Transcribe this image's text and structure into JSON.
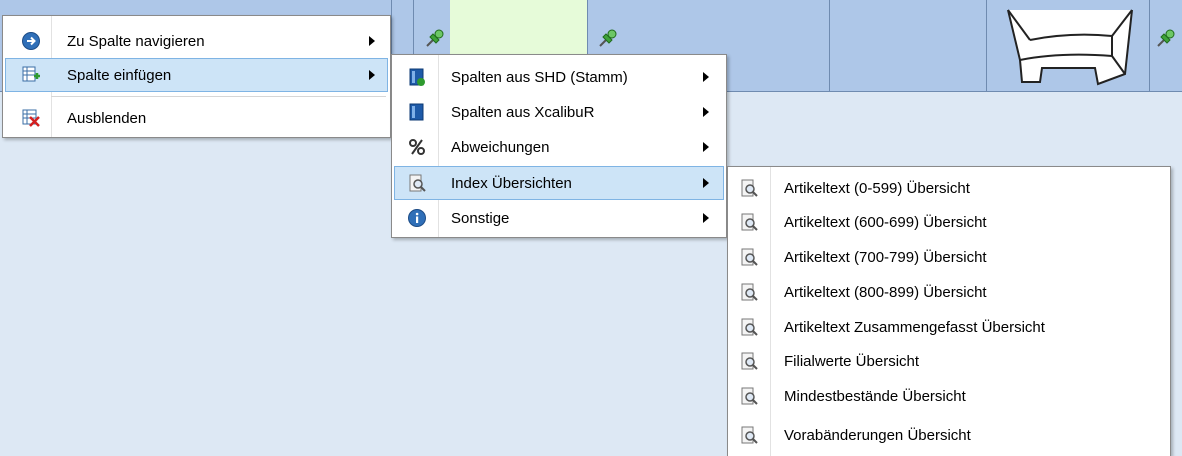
{
  "colors": {
    "grid_header": "#aec7e8",
    "grid_body": "#dde8f4",
    "highlight": "#cde4f7",
    "highlight_border": "#7fb4e4",
    "green_cell": "#e6fbd9"
  },
  "menu1": {
    "items": [
      {
        "label": "Zu Spalte navigieren",
        "icon": "arrow-right-circle-icon",
        "has_submenu": true
      },
      {
        "label": "Spalte einfügen",
        "icon": "insert-column-icon",
        "has_submenu": true,
        "highlighted": true
      },
      {
        "label": "Ausblenden",
        "icon": "hide-column-icon",
        "has_submenu": false
      }
    ]
  },
  "menu2": {
    "items": [
      {
        "label": "Spalten aus SHD (Stamm)",
        "icon": "book-shd-icon",
        "has_submenu": true
      },
      {
        "label": "Spalten aus XcalibuR",
        "icon": "book-xcalibur-icon",
        "has_submenu": true
      },
      {
        "label": "Abweichungen",
        "icon": "percent-icon",
        "has_submenu": true
      },
      {
        "label": "Index Übersichten",
        "icon": "report-magnifier-icon",
        "has_submenu": true,
        "highlighted": true
      },
      {
        "label": "Sonstige",
        "icon": "info-icon",
        "has_submenu": true
      }
    ]
  },
  "menu3": {
    "items": [
      {
        "label": "Artikeltext (0-599) Übersicht",
        "icon": "report-magnifier-icon"
      },
      {
        "label": "Artikeltext (600-699) Übersicht",
        "icon": "report-magnifier-icon"
      },
      {
        "label": "Artikeltext (700-799) Übersicht",
        "icon": "report-magnifier-icon"
      },
      {
        "label": "Artikeltext (800-899) Übersicht",
        "icon": "report-magnifier-icon"
      },
      {
        "label": "Artikeltext Zusammengefasst Übersicht",
        "icon": "report-magnifier-icon"
      },
      {
        "label": "Filialwerte Übersicht",
        "icon": "report-magnifier-icon"
      },
      {
        "label": "Mindestbestände Übersicht",
        "icon": "report-magnifier-icon"
      },
      {
        "label": "Vorabänderungen Übersicht",
        "icon": "report-magnifier-icon"
      }
    ]
  }
}
